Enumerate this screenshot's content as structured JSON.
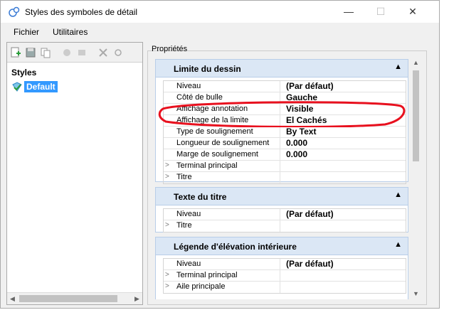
{
  "window": {
    "title": "Styles des symboles de détail",
    "minimize": "—",
    "maximize": "☐",
    "close": "✕"
  },
  "menu": [
    "Fichier",
    "Utilitaires"
  ],
  "left": {
    "header": "Styles",
    "selected": "Default"
  },
  "props_label": "Propriétés",
  "groups": [
    {
      "title": "Limite du dessin",
      "rows": [
        {
          "name": "Niveau",
          "value": "(Par défaut)",
          "expand": false
        },
        {
          "name": "Côté de bulle",
          "value": "Gauche",
          "expand": false
        },
        {
          "name": "Affichage annotation",
          "value": "Visible",
          "expand": false
        },
        {
          "name": "Affichage de la limite",
          "value": "El Cachés",
          "expand": false
        },
        {
          "name": "Type de soulignement",
          "value": "By Text",
          "expand": false
        },
        {
          "name": "Longueur de soulignement",
          "value": "0.000",
          "expand": false
        },
        {
          "name": "Marge de soulignement",
          "value": "0.000",
          "expand": false
        },
        {
          "name": "Terminal principal",
          "value": "",
          "expand": true
        },
        {
          "name": "Titre",
          "value": "",
          "expand": true
        }
      ]
    },
    {
      "title": "Texte du titre",
      "rows": [
        {
          "name": "Niveau",
          "value": "(Par défaut)",
          "expand": false
        },
        {
          "name": "Titre",
          "value": "",
          "expand": true
        }
      ]
    },
    {
      "title": "Légende d'élévation intérieure",
      "rows": [
        {
          "name": "Niveau",
          "value": "(Par défaut)",
          "expand": false
        },
        {
          "name": "Terminal principal",
          "value": "",
          "expand": true
        },
        {
          "name": "Aile principale",
          "value": "",
          "expand": true
        }
      ]
    }
  ],
  "annotation_color": "#e8101e"
}
